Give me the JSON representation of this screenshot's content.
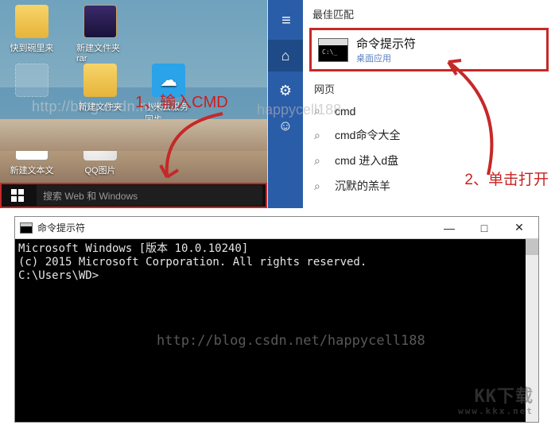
{
  "desktop": {
    "icons": [
      {
        "label": "快到碗里来",
        "kind": "folder"
      },
      {
        "label": "新建文件夹rar",
        "kind": "rar"
      },
      {
        "label": "",
        "kind": "blank"
      },
      {
        "label": "新建文件夹",
        "kind": "folder"
      },
      {
        "label": "小米云服务同步",
        "kind": "cloud"
      },
      {
        "label": "新建文本文",
        "kind": "txt"
      },
      {
        "label": "QQ图片",
        "kind": "qq"
      }
    ],
    "taskbar": {
      "search_placeholder": "搜索 Web 和 Windows"
    },
    "annotation": "1、输入CMD",
    "watermark": "http://blog.csdn.net/"
  },
  "search": {
    "header": "最佳匹配",
    "best": {
      "title": "命令提示符",
      "subtitle": "桌面应用"
    },
    "section": "网页",
    "rows": [
      "cmd",
      "cmd命令大全",
      "cmd 进入d盘",
      "沉默的羔羊"
    ],
    "annotation": "2、单击打开",
    "watermark": "happycell188"
  },
  "cmd": {
    "title": "命令提示符",
    "lines": [
      "Microsoft Windows [版本 10.0.10240]",
      "(c) 2015 Microsoft Corporation. All rights reserved.",
      "",
      "C:\\Users\\WD>"
    ],
    "watermark": "http://blog.csdn.net/happycell188",
    "btn_min": "—",
    "btn_max": "□",
    "btn_close": "✕"
  },
  "kkx": {
    "main": "KK下载",
    "sub": "www.kkx.net"
  }
}
